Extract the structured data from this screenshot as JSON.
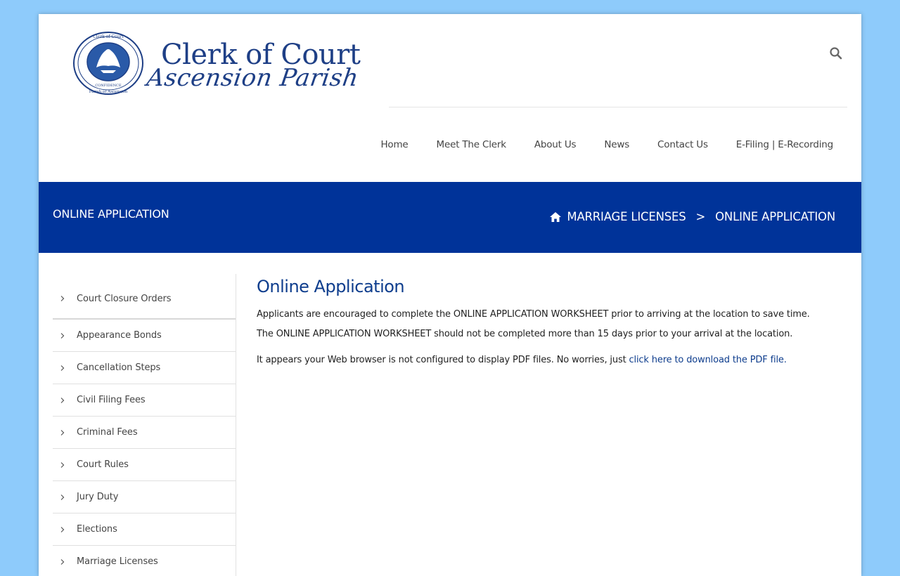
{
  "header": {
    "logo": {
      "title": "Clerk of Court",
      "subtitle": "Ascension Parish",
      "seal_text_top": "Clerk of Court",
      "seal_text_state": "STATE OF LOUISIANA",
      "seal_text_motto": "UNION JUSTICE CONFIDENCE",
      "seal_text_bottom": "Parish of Ascension"
    },
    "search_icon": "search-icon"
  },
  "nav": {
    "items": [
      {
        "label": "Home"
      },
      {
        "label": "Meet The Clerk"
      },
      {
        "label": "About Us"
      },
      {
        "label": "News"
      },
      {
        "label": "Contact Us"
      },
      {
        "label": "E-Filing | E-Recording"
      }
    ]
  },
  "banner": {
    "title": "ONLINE APPLICATION",
    "breadcrumb": {
      "home_icon": "home-icon",
      "items": [
        "MARRIAGE LICENSES",
        "ONLINE APPLICATION"
      ],
      "separator": ">"
    },
    "color": "#003399"
  },
  "sidebar": {
    "items": [
      {
        "label": "Court Closure Orders"
      },
      {
        "label": "Appearance Bonds"
      },
      {
        "label": "Cancellation Steps"
      },
      {
        "label": "Civil Filing Fees"
      },
      {
        "label": "Criminal Fees"
      },
      {
        "label": "Court Rules"
      },
      {
        "label": "Jury Duty"
      },
      {
        "label": "Elections"
      },
      {
        "label": "Marriage Licenses"
      }
    ]
  },
  "main": {
    "heading": "Online Application",
    "paragraph1": "Applicants are encouraged to complete the ONLINE APPLICATION WORKSHEET prior to arriving at the location to save time.",
    "paragraph2": "The ONLINE APPLICATION WORKSHEET should not be completed more than 15 days prior to your arrival at the location.",
    "pdf_notice": "It appears your Web browser is not configured to display PDF files. No worries, just ",
    "pdf_link": "click here to download the PDF file."
  },
  "colors": {
    "page_background": "#8ecbfb",
    "brand_blue": "#003399",
    "heading_blue": "#0e3d8d"
  }
}
